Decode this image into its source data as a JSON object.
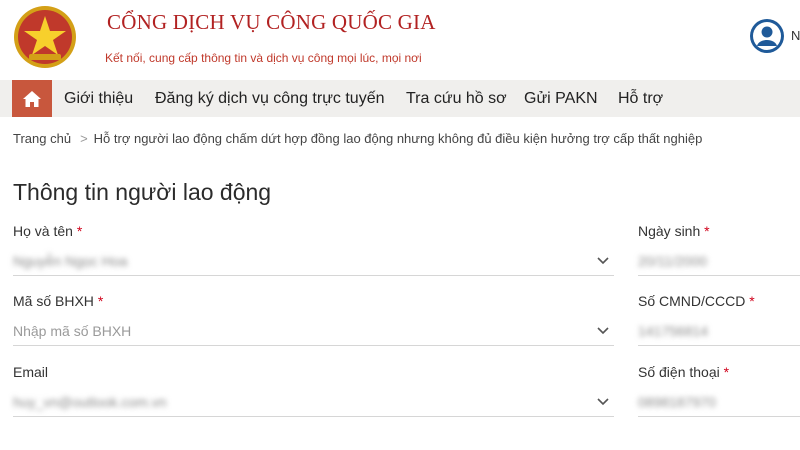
{
  "header": {
    "site_title": "CỔNG DỊCH VỤ CÔNG QUỐC GIA",
    "site_subtitle": "Kết nối, cung cấp thông tin và dịch vụ công mọi lúc, mọi nơi",
    "user_initial": "N"
  },
  "nav": {
    "items": [
      "Giới thiệu",
      "Đăng ký dịch vụ công trực tuyến",
      "Tra cứu hồ sơ",
      "Gửi PAKN",
      "Hỗ trợ"
    ]
  },
  "breadcrumb": {
    "home": "Trang chủ",
    "separator": ">",
    "current": "Hỗ trợ người lao động chấm dứt hợp đồng lao động nhưng không đủ điều kiện hưởng trợ cấp thất nghiệp"
  },
  "section": {
    "title": "Thông tin người lao động"
  },
  "form": {
    "required_mark": "*",
    "full_name": {
      "label": "Họ và tên",
      "value": "Nguyễn Ngọc Hoa"
    },
    "birth_date": {
      "label": "Ngày sinh",
      "value": "20/11/2000"
    },
    "social_insurance": {
      "label": "Mã số BHXH",
      "placeholder": "Nhập mã số BHXH"
    },
    "id_number": {
      "label": "Số CMND/CCCD",
      "value": "141756814"
    },
    "email": {
      "label": "Email",
      "value": "huy_vn@outlook.com.vn"
    },
    "phone": {
      "label": "Số điện thoại",
      "value": "0898187970"
    }
  },
  "colors": {
    "brand_red": "#b22222",
    "home_button": "#c8573d",
    "nav_background": "#f0efed",
    "required": "#d0021b"
  },
  "icons": [
    "national-emblem-icon",
    "user-avatar-icon",
    "home-icon",
    "chevron-down-icon"
  ]
}
